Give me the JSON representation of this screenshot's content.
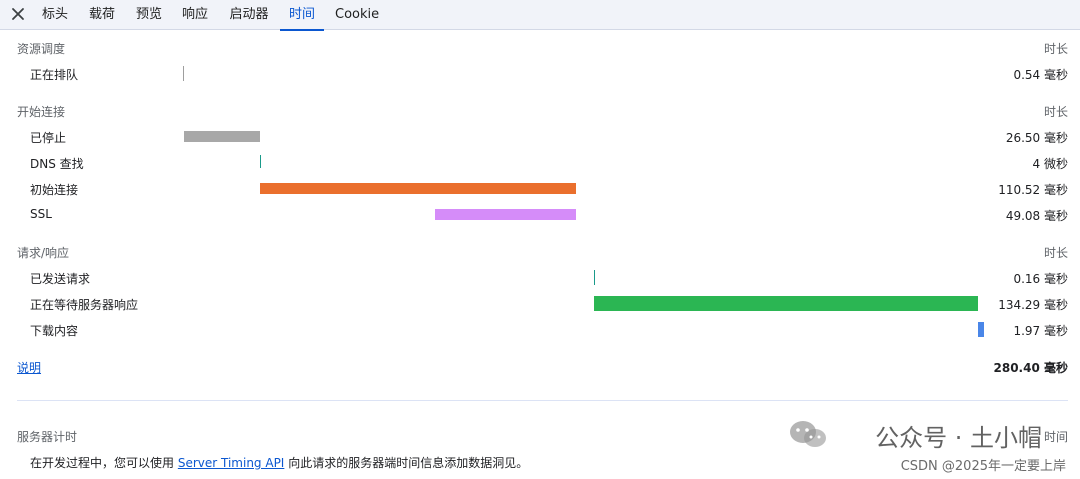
{
  "tabs": [
    {
      "label": "标头"
    },
    {
      "label": "载荷"
    },
    {
      "label": "预览"
    },
    {
      "label": "响应"
    },
    {
      "label": "启动器"
    },
    {
      "label": "时间",
      "active": true
    },
    {
      "label": "Cookie"
    }
  ],
  "sections": {
    "scheduling": {
      "title": "资源调度",
      "duration_header": "时长",
      "rows": [
        {
          "label": "正在排队",
          "value": "0.54 毫秒"
        }
      ]
    },
    "connection": {
      "title": "开始连接",
      "duration_header": "时长",
      "rows": [
        {
          "label": "已停止",
          "value": "26.50 毫秒"
        },
        {
          "label": "DNS 查找",
          "value": "4 微秒"
        },
        {
          "label": "初始连接",
          "value": "110.52 毫秒"
        },
        {
          "label": "SSL",
          "value": "49.08 毫秒"
        }
      ]
    },
    "request": {
      "title": "请求/响应",
      "duration_header": "时长",
      "rows": [
        {
          "label": "已发送请求",
          "value": "0.16 毫秒"
        },
        {
          "label": "正在等待服务器响应",
          "value": "134.29 毫秒"
        },
        {
          "label": "下载内容",
          "value": "1.97 毫秒"
        }
      ]
    }
  },
  "explanation_link": "说明",
  "total": "280.40 毫秒",
  "server_timing": {
    "title": "服务器计时",
    "time_header": "时间",
    "note_before": "在开发过程中，您可以使用",
    "note_link": "Server Timing API",
    "note_after": "向此请求的服务器端时间信息添加数据洞见。"
  },
  "watermark": {
    "main": "公众号 · 土小帽",
    "sub": "CSDN @2025年一定要上岸"
  },
  "colors": {
    "stalled": "#a8a8a8",
    "dns": "#1a9a8a",
    "initial_connection": "#ea6f2d",
    "ssl": "#d58cf9",
    "request_sent": "#1a9a8a",
    "waiting": "#2bb653",
    "download": "#4a86e8",
    "queue": "#9e9e9e",
    "accent": "#0b57d0"
  },
  "icons": {
    "close": "close-icon",
    "wechat": "wechat-icon"
  }
}
